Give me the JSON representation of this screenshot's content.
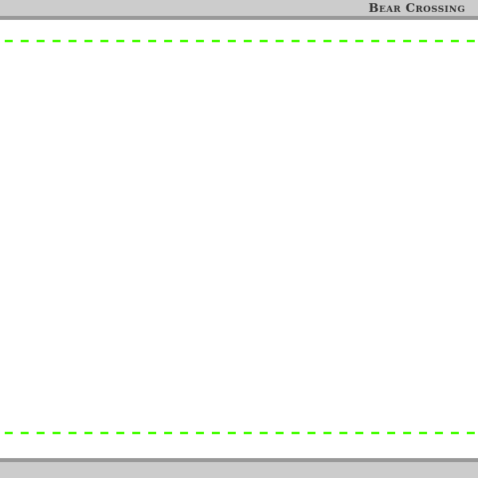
{
  "header": {
    "title": "Bear Crossing"
  },
  "colors": {
    "lane_line": "#44ff00",
    "bar_light": "#cccccc",
    "bar_dark": "#999999"
  }
}
